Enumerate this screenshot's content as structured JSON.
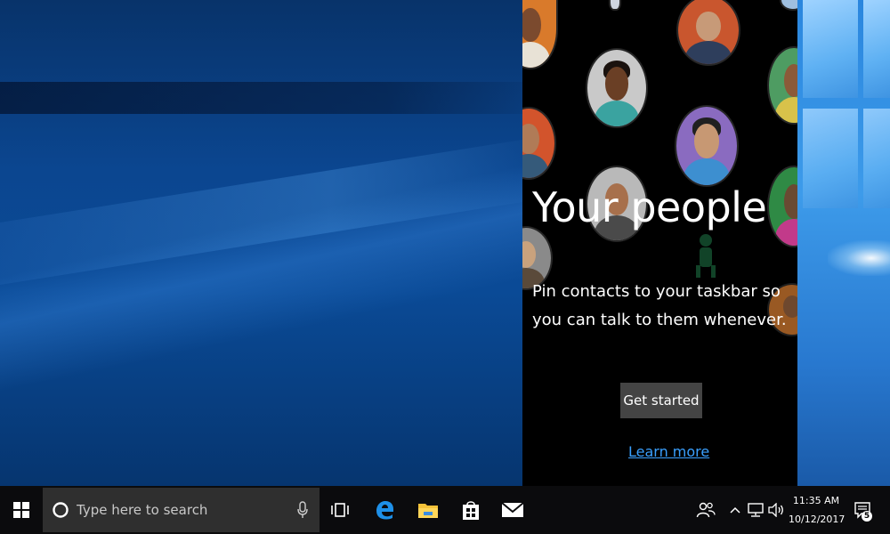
{
  "flyout": {
    "title": "Your people",
    "description": "Pin contacts to your taskbar so you can talk to them whenever.",
    "primary_button": "Get started",
    "link": "Learn more",
    "background_color": "#000000",
    "link_color": "#3aa0ff",
    "button_color": "#444444"
  },
  "taskbar": {
    "search": {
      "placeholder": "Type here to search",
      "icon": "cortana-circle-icon",
      "mic_icon": "microphone-icon"
    },
    "pinned_apps": [
      {
        "name": "Task View",
        "icon": "task-view-icon"
      },
      {
        "name": "Microsoft Edge",
        "icon": "edge-icon"
      },
      {
        "name": "File Explorer",
        "icon": "folder-icon"
      },
      {
        "name": "Microsoft Store",
        "icon": "store-bag-icon"
      },
      {
        "name": "Mail",
        "icon": "envelope-icon"
      }
    ],
    "tray": {
      "people_icon": "people-icon",
      "icons": [
        "chevron-up-icon",
        "network-icon",
        "volume-icon"
      ],
      "time": "11:35 AM",
      "date": "10/12/2017",
      "notification_count": "5"
    },
    "background_color": "#0b0b0d",
    "search_box_color": "#2f2f2f"
  },
  "desktop": {
    "wallpaper": "Windows 10 hero",
    "accent_color": "#0b4690"
  }
}
